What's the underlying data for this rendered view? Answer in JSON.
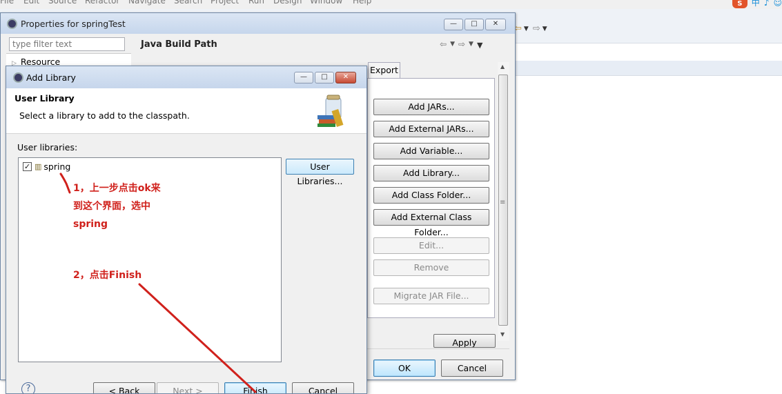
{
  "eclipse": {
    "menu": [
      "File",
      "Edit",
      "Source",
      "Refactor",
      "Navigate",
      "Search",
      "Project",
      "Run",
      "Design",
      "Window",
      "Help"
    ],
    "tray": {
      "logo": "S",
      "ime": "中",
      "moon": "♪",
      "face": "☺"
    }
  },
  "properties_dialog": {
    "title": "Properties for springTest",
    "filter_placeholder": "type filter text",
    "tree_item": "Resource",
    "pane_title": "Java Build Path",
    "tab_export": "Export",
    "buttons": {
      "add_jars": "Add JARs...",
      "add_external_jars": "Add External JARs...",
      "add_variable": "Add Variable...",
      "add_library": "Add Library...",
      "add_class_folder": "Add Class Folder...",
      "add_external_class_folder": "Add External Class Folder...",
      "edit": "Edit...",
      "remove": "Remove",
      "migrate_jar": "Migrate JAR File..."
    },
    "apply": "Apply",
    "ok": "OK",
    "cancel": "Cancel"
  },
  "add_library_dialog": {
    "title": "Add Library",
    "header_title": "User Library",
    "header_desc": "Select a library to add to the classpath.",
    "list_label": "User libraries:",
    "libraries": [
      {
        "name": "spring",
        "checked": true
      }
    ],
    "user_libraries_button": "User Libraries...",
    "help": "?",
    "back": "< Back",
    "next": "Next >",
    "finish": "Finish",
    "cancel": "Cancel"
  },
  "annotations": {
    "step1_line1": "1，上一步点击ok来",
    "step1_line2": "到这个界面，选中",
    "step1_line3": "spring",
    "step2": "2，点击Finish",
    "color": "#d0211c"
  },
  "window_buttons": {
    "minimize": "—",
    "maximize": "□",
    "close": "✕"
  }
}
